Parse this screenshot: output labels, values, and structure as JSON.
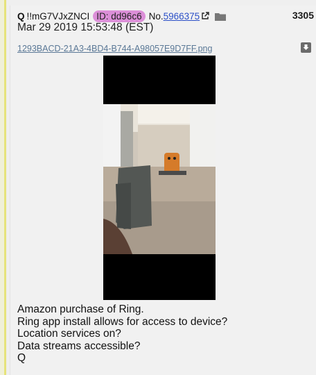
{
  "post": {
    "name": "Q",
    "tripcode": "!!mG7VJxZNCI",
    "id_label": "ID: dd96c6",
    "no_label": "No.",
    "post_number": "5966375",
    "reply_count": "3305",
    "date": "Mar 29 2019 15:53:48 (EST)",
    "filename": "1293BACD-21A3-4BD4-B744-A98057E9D7FF.png",
    "lines": [
      "Amazon purchase of Ring.",
      "Ring app install allows for access to device?",
      "Location services on?",
      "Data streams accessible?",
      "Q"
    ]
  },
  "colors": {
    "id_badge": "#dc8fd8",
    "link": "#2b4fc7",
    "filename_link": "#5a7896",
    "left_accent": "#e6e37a"
  },
  "icons": {
    "external_link": "external-link-icon",
    "folder": "folder-icon",
    "download": "download-icon"
  }
}
